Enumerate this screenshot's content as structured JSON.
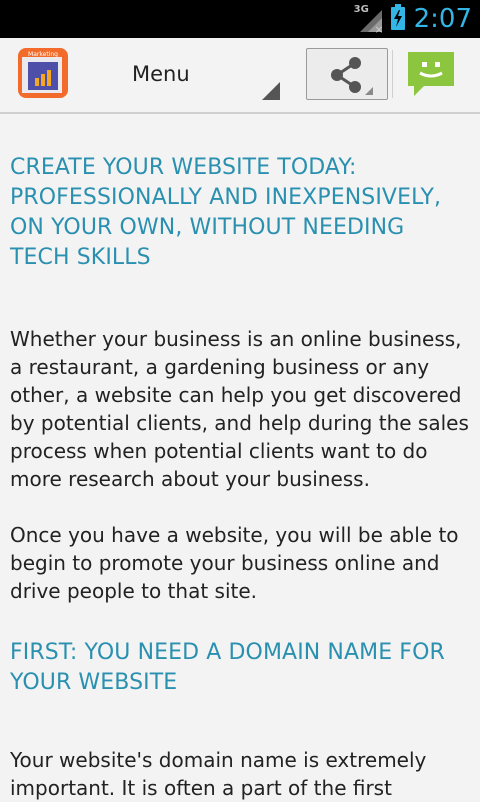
{
  "statusbar": {
    "network": "3G",
    "time": "2:07"
  },
  "actionbar": {
    "app_icon_label": "Marketing",
    "menu_label": "Menu"
  },
  "content": {
    "heading1": "CREATE YOUR WEBSITE TODAY: PROFESSIONALLY AND INEXPENSIVELY, ON YOUR OWN, WITHOUT NEEDING TECH SKILLS",
    "paragraph1": "Whether your business is an online business, a restaurant, a gardening business or any other, a website can help you get discovered by potential clients, and help during the sales process when potential clients want to do more research about your business.",
    "paragraph2": "Once you have a website, you will be able to begin to promote your business online and drive people to that site.",
    "heading2": "FIRST: YOU NEED A DOMAIN NAME FOR YOUR WEBSITE",
    "paragraph3": "Your website's domain name is extremely important. It is often a part of the first"
  },
  "colors": {
    "heading": "#2a90b0",
    "status_accent": "#33b5e5",
    "chat_green": "#8cc63f",
    "app_icon_orange": "#f26b2a"
  }
}
